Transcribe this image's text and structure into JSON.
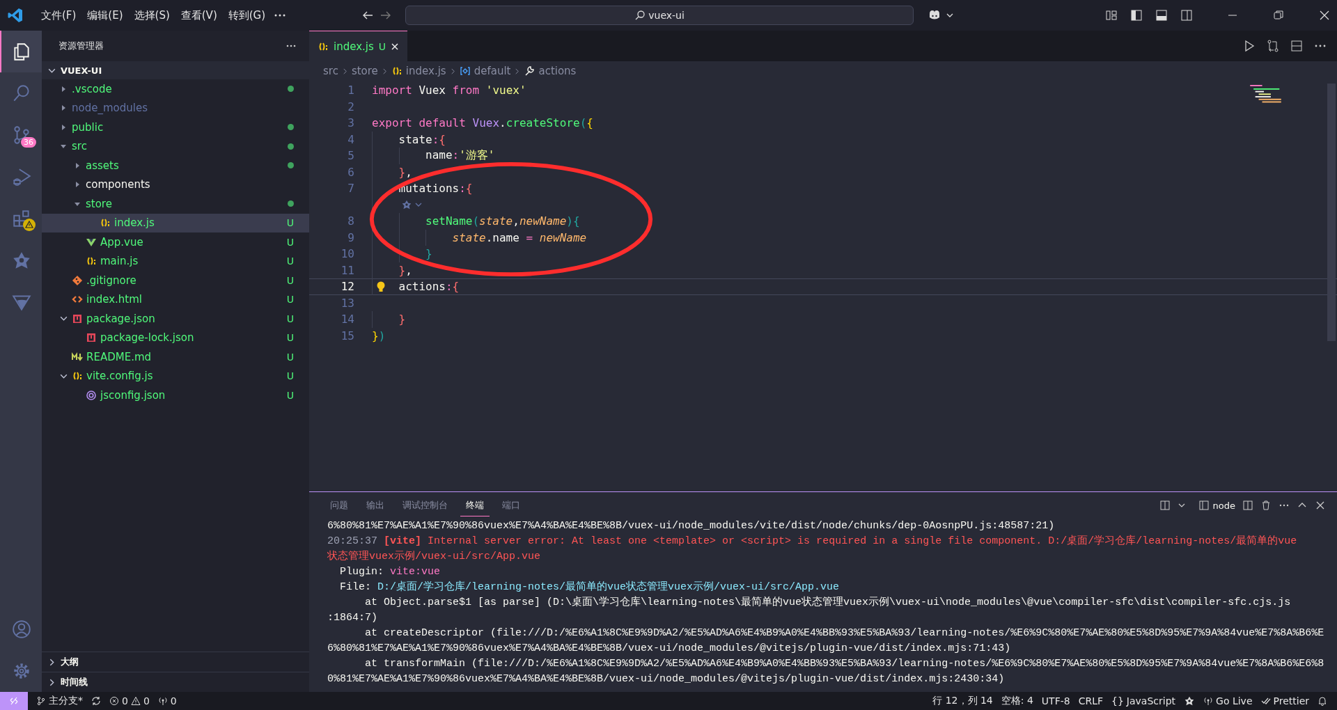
{
  "title_bar": {
    "menu": [
      "文件(F)",
      "编辑(E)",
      "选择(S)",
      "查看(V)",
      "转到(G)"
    ],
    "search": {
      "value": "vuex-ui"
    }
  },
  "activity_bar": {
    "items": [
      {
        "kind": "explorer",
        "selected": true
      },
      {
        "kind": "search",
        "selected": false
      },
      {
        "kind": "source-control",
        "selected": false,
        "badge": "36"
      },
      {
        "kind": "run",
        "selected": false
      },
      {
        "kind": "extensions",
        "selected": false,
        "warning": true
      },
      {
        "kind": "star",
        "selected": false
      },
      {
        "kind": "triangle",
        "selected": false
      }
    ],
    "bottom": [
      {
        "kind": "account"
      },
      {
        "kind": "settings"
      }
    ]
  },
  "sidebar": {
    "title": "资源管理器",
    "root": {
      "name": "VUEX-UI",
      "expanded": true
    },
    "tree": [
      {
        "name": ".vscode",
        "kind": "folder",
        "expanded": false,
        "selected": false,
        "modified": true,
        "ignored": false,
        "dot": true
      },
      {
        "name": "node_modules",
        "kind": "folder",
        "expanded": false,
        "selected": false,
        "ignored": true,
        "dot": false
      },
      {
        "name": "public",
        "kind": "folder",
        "expanded": false,
        "selected": false,
        "modified": true,
        "ignored": false,
        "dot": true
      },
      {
        "name": "src",
        "kind": "folder",
        "expanded": true,
        "selected": false,
        "modified": true,
        "ignored": false,
        "dot": true,
        "children": [
          {
            "name": "assets",
            "kind": "folder",
            "expanded": false,
            "selected": false,
            "modified": true,
            "ignored": false,
            "dot": true
          },
          {
            "name": "components",
            "kind": "folder",
            "expanded": false,
            "selected": false,
            "modified": false,
            "ignored": false,
            "dot": false
          },
          {
            "name": "store",
            "kind": "folder",
            "expanded": true,
            "selected": false,
            "modified": true,
            "ignored": false,
            "dot": true,
            "children": [
              {
                "name": "index.js",
                "kind": "js",
                "selected": true,
                "modified": true,
                "ignored": false,
                "dot": false,
                "badge": "U"
              }
            ]
          },
          {
            "name": "App.vue",
            "kind": "vue",
            "selected": false,
            "modified": true,
            "ignored": false,
            "dot": false,
            "badge": "U"
          },
          {
            "name": "main.js",
            "kind": "js",
            "selected": false,
            "modified": true,
            "ignored": false,
            "dot": false,
            "badge": "U"
          }
        ]
      },
      {
        "name": ".gitignore",
        "kind": "git",
        "selected": false,
        "modified": true,
        "ignored": false,
        "dot": false,
        "badge": "U"
      },
      {
        "name": "index.html",
        "kind": "html",
        "selected": false,
        "modified": true,
        "ignored": false,
        "dot": false,
        "badge": "U"
      },
      {
        "name": "package.json",
        "kind": "npm",
        "expanded": true,
        "selected": false,
        "modified": true,
        "ignored": false,
        "dot": false,
        "badge": "U",
        "children": [
          {
            "name": "package-lock.json",
            "kind": "npm",
            "selected": false,
            "modified": true,
            "ignored": false,
            "dot": false,
            "badge": "U"
          }
        ]
      },
      {
        "name": "README.md",
        "kind": "md",
        "selected": false,
        "modified": true,
        "ignored": false,
        "dot": false,
        "badge": "U"
      },
      {
        "name": "vite.config.js",
        "kind": "js",
        "expanded": true,
        "selected": false,
        "modified": true,
        "ignored": false,
        "dot": false,
        "badge": "U",
        "children": [
          {
            "name": "jsconfig.json",
            "kind": "jsconfig",
            "selected": false,
            "modified": true,
            "ignored": false,
            "dot": false,
            "badge": "U"
          }
        ]
      }
    ],
    "sections": [
      {
        "title": "大纲",
        "expanded": false
      },
      {
        "title": "时间线",
        "expanded": false
      }
    ]
  },
  "editor": {
    "tabs": [
      {
        "label": "index.js",
        "kind": "js",
        "badge": "U",
        "selected": true
      }
    ],
    "breadcrumbs": [
      {
        "text": "src",
        "kind": "folder"
      },
      {
        "text": "store",
        "kind": "folder"
      },
      {
        "text": "index.js",
        "kind": "js"
      },
      {
        "text": "default",
        "kind": "module"
      },
      {
        "text": "actions",
        "kind": "property"
      }
    ],
    "lines": [
      {
        "number": "1",
        "tokens": [
          {
            "text": "import",
            "kind": "kw"
          },
          {
            "text": " Vuex ",
            "kind": "plain"
          },
          {
            "text": "from",
            "kind": "kw"
          },
          {
            "text": " 'vuex'",
            "kind": "str"
          }
        ]
      },
      {
        "number": "2"
      },
      {
        "number": "3",
        "tokens": [
          {
            "text": "export default",
            "kind": "kw"
          },
          {
            "text": " Vuex",
            "kind": "cls"
          },
          {
            "text": ".",
            "kind": "plain"
          },
          {
            "text": "createStore",
            "kind": "fn"
          },
          {
            "text": "(",
            "kind": "b3"
          },
          {
            "text": "{",
            "kind": "b1"
          }
        ]
      },
      {
        "number": "4",
        "tokens": [
          {
            "text": "    state",
            "kind": "plain"
          },
          {
            "text": ":",
            "kind": "kw"
          },
          {
            "text": "{",
            "kind": "b2"
          }
        ]
      },
      {
        "number": "5",
        "tokens": [
          {
            "text": "        name",
            "kind": "plain"
          },
          {
            "text": ":",
            "kind": "kw"
          },
          {
            "text": "'游客'",
            "kind": "str"
          }
        ]
      },
      {
        "number": "6",
        "tokens": [
          {
            "text": "    }",
            "kind": "b2"
          },
          {
            "text": ",",
            "kind": "plain"
          }
        ]
      },
      {
        "number": "7",
        "tokens": [
          {
            "text": "    mutations",
            "kind": "plain"
          },
          {
            "text": ":",
            "kind": "kw"
          },
          {
            "text": "{",
            "kind": "b2"
          }
        ]
      },
      {
        "kind": "codelens"
      },
      {
        "number": "8",
        "tokens": [
          {
            "text": "        setName",
            "kind": "fn"
          },
          {
            "text": "(",
            "kind": "b3"
          },
          {
            "text": "state",
            "kind": "param"
          },
          {
            "text": ",",
            "kind": "plain"
          },
          {
            "text": "newName",
            "kind": "param"
          },
          {
            "text": ")",
            "kind": "b3"
          },
          {
            "text": "{",
            "kind": "b3"
          }
        ]
      },
      {
        "number": "9",
        "tokens": [
          {
            "text": "            state",
            "kind": "param"
          },
          {
            "text": ".name",
            "kind": "plain"
          },
          {
            "text": " = ",
            "kind": "kw"
          },
          {
            "text": "newName",
            "kind": "param"
          }
        ]
      },
      {
        "number": "10",
        "tokens": [
          {
            "text": "        }",
            "kind": "b3"
          }
        ]
      },
      {
        "number": "11",
        "tokens": [
          {
            "text": "    }",
            "kind": "b2"
          },
          {
            "text": ",",
            "kind": "plain"
          }
        ]
      },
      {
        "number": "12",
        "current": true,
        "lightbulb": true,
        "tokens": [
          {
            "text": "    actions",
            "kind": "plain"
          },
          {
            "text": ":",
            "kind": "kw"
          },
          {
            "text": "{",
            "kind": "b2"
          }
        ]
      },
      {
        "number": "13"
      },
      {
        "number": "14",
        "tokens": [
          {
            "text": "    }",
            "kind": "b2"
          }
        ]
      },
      {
        "number": "15",
        "tokens": [
          {
            "text": "}",
            "kind": "b1"
          },
          {
            "text": ")",
            "kind": "b3"
          }
        ]
      }
    ]
  },
  "panel": {
    "tabs": [
      {
        "label": "问题",
        "selected": false
      },
      {
        "label": "输出",
        "selected": false
      },
      {
        "label": "调试控制台",
        "selected": false
      },
      {
        "label": "终端",
        "selected": true
      },
      {
        "label": "端口",
        "selected": false
      }
    ],
    "terminal_name": "node",
    "lines": [
      [
        {
          "text": "6%80%81%E7%AE%A1%E7%90%86vuex%E7%A4%BA%E4%BE%8B/vuex-ui/node_modules/vite/dist/node/chunks/dep-0AosnpPU.js:48587:21)",
          "kind": "plain"
        }
      ],
      [
        {
          "text": "20:25:37 ",
          "kind": "dim"
        },
        {
          "text": "[vite]",
          "kind": "tag"
        },
        {
          "text": " Internal server error: At least one <template> or <script> is required in a single file component. D:/桌面/学习仓库/learning-notes/最简单的vue",
          "kind": "error"
        }
      ],
      [
        {
          "text": "状态管理vuex示例/vuex-ui/src/App.vue",
          "kind": "error"
        }
      ],
      [
        {
          "text": "  Plugin: ",
          "kind": "plain"
        },
        {
          "text": "vite:vue",
          "kind": "accent"
        }
      ],
      [
        {
          "text": "  File: ",
          "kind": "plain"
        },
        {
          "text": "D:/桌面/学习仓库/learning-notes/最简单的vue状态管理vuex示例/vuex-ui/src/App.vue",
          "kind": "link"
        }
      ],
      [
        {
          "text": "      at Object.parse$1 [as parse] (D:\\桌面\\学习仓库\\learning-notes\\最简单的vue状态管理vuex示例\\vuex-ui\\node_modules\\@vue\\compiler-sfc\\dist\\compiler-sfc.cjs.js",
          "kind": "plain"
        }
      ],
      [
        {
          "text": ":1864:7)",
          "kind": "plain"
        }
      ],
      [
        {
          "text": "      at createDescriptor (file:///D:/%E6%A1%8C%E9%9D%A2/%E5%AD%A6%E4%B9%A0%E4%BB%93%E5%BA%93/learning-notes/%E6%9C%80%E7%AE%80%E5%8D%95%E7%9A%84vue%E7%8A%B6%E",
          "kind": "plain"
        }
      ],
      [
        {
          "text": "6%80%81%E7%AE%A1%E7%90%86vuex%E7%A4%BA%E4%BE%8B/vuex-ui/node_modules/@vitejs/plugin-vue/dist/index.mjs:71:43)",
          "kind": "plain"
        }
      ],
      [
        {
          "text": "      at transformMain (file:///D:/%E6%A1%8C%E9%9D%A2/%E5%AD%A6%E4%B9%A0%E4%BB%93%E5%BA%93/learning-notes/%E6%9C%80%E7%AE%80%E5%8D%95%E7%9A%84vue%E7%8A%B6%E6%8",
          "kind": "plain"
        }
      ],
      [
        {
          "text": "0%81%E7%AE%A1%E7%90%86vuex%E7%A4%BA%E4%BE%8B/vuex-ui/node_modules/@vitejs/plugin-vue/dist/index.mjs:2430:34)",
          "kind": "plain"
        }
      ]
    ]
  },
  "status_bar": {
    "left": [
      {
        "kind": "remote"
      },
      {
        "kind": "branch",
        "text": "主分支*"
      },
      {
        "kind": "sync"
      },
      {
        "kind": "problems",
        "errors": "0",
        "warnings": "0"
      },
      {
        "kind": "ports",
        "text": "0"
      }
    ],
    "right": [
      {
        "kind": "text",
        "text": "行 12，列 14"
      },
      {
        "kind": "text",
        "text": "空格: 4"
      },
      {
        "kind": "text",
        "text": "UTF-8"
      },
      {
        "kind": "text",
        "text": "CRLF"
      },
      {
        "kind": "language",
        "icon_text": "{}",
        "text": "JavaScript"
      },
      {
        "kind": "copilot"
      },
      {
        "kind": "golive",
        "text": "Go Live"
      },
      {
        "kind": "prettier",
        "text": "Prettier"
      },
      {
        "kind": "bell"
      }
    ]
  }
}
